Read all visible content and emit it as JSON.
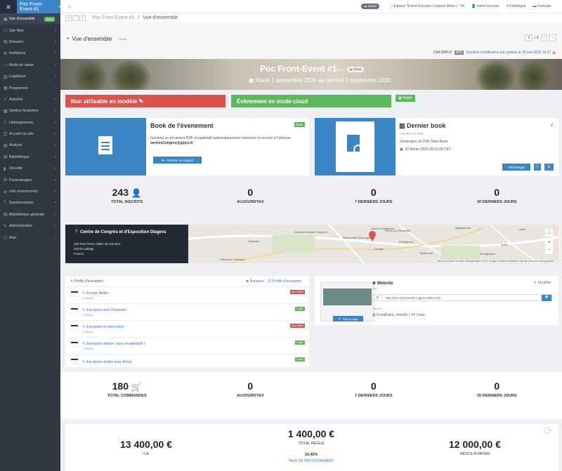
{
  "sidebar": {
    "event": "Poc Front-Event #1",
    "items": [
      {
        "icon": "▣",
        "label": "Vue d'ensemble",
        "badge": "New",
        "active": true
      },
      {
        "icon": "▢",
        "label": "Site Web"
      },
      {
        "icon": "▤",
        "label": "Dossiers"
      },
      {
        "icon": "✉",
        "label": "Invitations"
      },
      {
        "icon": "▭",
        "label": "Mode de saisie"
      },
      {
        "icon": "▥",
        "label": "Logistique"
      },
      {
        "icon": "▦",
        "label": "Programme"
      },
      {
        "icon": "✓",
        "label": "Activités"
      },
      {
        "icon": "▩",
        "label": "Gestion financière"
      },
      {
        "icon": "⌂",
        "label": "Hébergements"
      },
      {
        "icon": "☰",
        "label": "Accueil sur site"
      },
      {
        "icon": "▨",
        "label": "Analyse"
      },
      {
        "icon": "▤",
        "label": "Bibliothèque"
      },
      {
        "icon": "▮",
        "label": "Sécurité"
      },
      {
        "icon": "⚙",
        "label": "Paramétrages"
      },
      {
        "icon": "⇄",
        "label": "Inter-évènements"
      },
      {
        "icon": "?",
        "label": "Questionnaires"
      },
      {
        "icon": "▤",
        "label": "Bibliothèque générale"
      },
      {
        "icon": "✎",
        "label": "Administration"
      },
      {
        "icon": "ⓘ",
        "label": "Aide"
      }
    ]
  },
  "topbar": {
    "cloud": "Cloud",
    "espace": "Espace \"Event-Success ( espace démo ) \" #n",
    "user": "event success",
    "history": "Historique",
    "language": "Français"
  },
  "breadcrumb": {
    "event": "Poc Front-Event #1",
    "current": "Vue d'ensemble"
  },
  "page": {
    "title": "Vue d'ensemble",
    "id": "#6406",
    "pager_current": "3",
    "pager_total": "/ 4",
    "lastmod_prefix": "Clef GIPCO",
    "lastmod_code": "A00",
    "lastmod_text": "Dernière modification par system le 30 mai 2022 16:37"
  },
  "banner": {
    "title": "Poc Front-Event #1",
    "id": "#6406",
    "cloud": "Cloud",
    "dates": "Mardi 1 septembre 2020 au samedi 5 septembre 2020"
  },
  "status": {
    "model": "Non utilisable en modèle",
    "cloud": "Évènement en mode cloud",
    "published": "Publié"
  },
  "book": {
    "title": "Book de l'évenement",
    "badge": "New",
    "desc": "Générez un document PDF récapitulatif automatiquement mémorisé et envoyé à l'adresse",
    "email": "serviceCongres@gipco.fr",
    "button": "Générer un rapport"
  },
  "lastbook": {
    "title": "Dernier book",
    "id": "Activité #347285",
    "desc": "Génération du PDF Main Book",
    "date": "22 février 2022 09:51:08 CET",
    "download": "Télécharger"
  },
  "stats1": [
    {
      "value": "243",
      "label": "TOTAL INSCRITS"
    },
    {
      "value": "0",
      "label": "AUJOURD'HUI"
    },
    {
      "value": "0",
      "label": "7 DERNIERS JOURS"
    },
    {
      "value": "0",
      "label": "30 DERNIERS JOURS"
    }
  ],
  "venue": {
    "name": "Centre de Congrès et d'Exposition Diagora",
    "street": "150 Rue Pierre Gilles de Gennes",
    "city": "31670 Labège",
    "country": "France"
  },
  "map": {
    "places": [
      "Ramonville-Saint-Agne",
      "Carrefour Market Ougnaux",
      "Ougnaux",
      "Villeneuve-Tolosane",
      "Quint-Fonsegrives",
      "Orens-de-Gameville",
      "Labège",
      "Ayguesvives",
      "Aurin",
      "Montgiscard",
      "Lanta",
      "Escalquens",
      "Belberaud"
    ],
    "footer": "Raccourcis clavier   Données cartographiques ©2022 Google   Conditions d'utilisation   Signaler une erreur cartographique"
  },
  "profiles": {
    "title": "Profils d'inscription",
    "new": "Nouveau",
    "count": "11 Profils d'inscription",
    "items": [
      {
        "name": "Groupe Atelier",
        "steps": "4 Étapes",
        "status": "Non Publié",
        "color": "red"
      },
      {
        "name": "Inscription avec Paiement",
        "steps": "5 Étapes",
        "status": "Publié",
        "color": "green"
      },
      {
        "name": "Inscription et réservation",
        "steps": "3 Étapes",
        "status": "Non Publié",
        "color": "red"
      },
      {
        "name": "Inscription simple ( sans récapitulatif )",
        "steps": "2 Étapes",
        "status": "Publié",
        "color": "green"
      },
      {
        "name": "Inscription simple avec Achat",
        "steps": "",
        "status": "Publié",
        "color": "green"
      }
    ]
  },
  "website": {
    "title": "Website",
    "modify": "Modifier",
    "lien_label": "Lien",
    "url": "http://poc-front-event-1.gipco-adns.com",
    "gabarit_label": "Gabarit",
    "gabarit": "FrontEvent_ministie ( V4 ) new",
    "view": "Voir la page"
  },
  "stats2": [
    {
      "value": "180",
      "label": "TOTAL COMMANDES"
    },
    {
      "value": "0",
      "label": "AUJOURD'HUI"
    },
    {
      "value": "0",
      "label": "7 DERNIERS JOURS"
    },
    {
      "value": "0",
      "label": "30 DERNIERS JOURS"
    }
  ],
  "finance": {
    "ca_value": "13 400,00 €",
    "ca_label": "CA",
    "regle_value": "1 400,00 €",
    "regle_label": "TOTAL REGLE",
    "taux_value": "10,45%",
    "taux_label": "TAUX DE RECOUVREMENT",
    "reste_value": "12 000,00 €",
    "reste_label": "RESTE A PAYER"
  },
  "colors": {
    "sidebar": "#2f3743",
    "accent": "#3d86c6",
    "red": "#d9534f",
    "green": "#5cb85c",
    "link": "#3d74b8"
  }
}
